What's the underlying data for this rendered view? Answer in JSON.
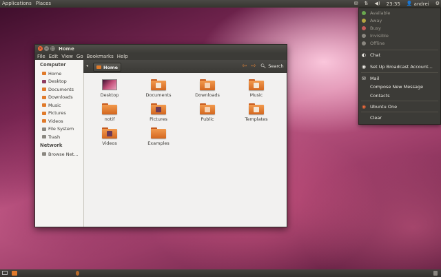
{
  "top_panel": {
    "menu": [
      "Applications",
      "Places"
    ],
    "clock": "23:35",
    "user": "andrei",
    "icons": [
      "mail-icon",
      "network-icon",
      "volume-icon",
      "user-icon",
      "gear-icon"
    ]
  },
  "indicator_menu": {
    "statuses": [
      {
        "label": "Available",
        "color": "#6aa84f"
      },
      {
        "label": "Away",
        "color": "#b5a642"
      },
      {
        "label": "Busy",
        "color": "#c45a5a"
      },
      {
        "label": "Invisible",
        "color": "#8a8780"
      },
      {
        "label": "Offline",
        "color": "#8a8780"
      }
    ],
    "chat": "Chat",
    "broadcast": "Set Up Broadcast Account...",
    "mail": "Mail",
    "compose": "Compose New Message",
    "contacts": "Contacts",
    "ubuntu_one": "Ubuntu One",
    "clear": "Clear"
  },
  "window": {
    "title": "Home",
    "menu": [
      "File",
      "Edit",
      "View",
      "Go",
      "Bookmarks",
      "Help"
    ],
    "path_button": "Home",
    "search": "Search",
    "sidebar": {
      "computer_heading": "Computer",
      "computer_items": [
        {
          "label": "Home",
          "icon": "home-folder-icon",
          "color": "#e07a2a"
        },
        {
          "label": "Desktop",
          "icon": "desktop-icon",
          "color": "#8e3b5f"
        },
        {
          "label": "Documents",
          "icon": "documents-folder-icon",
          "color": "#e07a2a"
        },
        {
          "label": "Downloads",
          "icon": "downloads-folder-icon",
          "color": "#e07a2a"
        },
        {
          "label": "Music",
          "icon": "music-folder-icon",
          "color": "#e07a2a"
        },
        {
          "label": "Pictures",
          "icon": "pictures-folder-icon",
          "color": "#e07a2a"
        },
        {
          "label": "Videos",
          "icon": "videos-folder-icon",
          "color": "#e07a2a"
        },
        {
          "label": "File System",
          "icon": "file-system-icon",
          "color": "#8a8780"
        },
        {
          "label": "Trash",
          "icon": "trash-icon",
          "color": "#8a8780"
        }
      ],
      "network_heading": "Network",
      "network_items": [
        {
          "label": "Browse Net...",
          "icon": "network-icon",
          "color": "#8a8780"
        }
      ]
    },
    "files": [
      {
        "label": "Desktop",
        "type": "desktop",
        "emblem": "desktop-icon"
      },
      {
        "label": "Documents",
        "type": "folder",
        "emblem": "documents-icon",
        "emblem_color": "#f4e7d7"
      },
      {
        "label": "Downloads",
        "type": "folder",
        "emblem": "downloads-icon",
        "emblem_color": "#f6d3b4"
      },
      {
        "label": "Music",
        "type": "folder",
        "emblem": "music-icon",
        "emblem_color": "#f4e7d7"
      },
      {
        "label": "notif",
        "type": "folder",
        "emblem": "",
        "emblem_color": ""
      },
      {
        "label": "Pictures",
        "type": "folder",
        "emblem": "pictures-icon",
        "emblem_color": "#6b3a56"
      },
      {
        "label": "Public",
        "type": "folder",
        "emblem": "public-icon",
        "emblem_color": "#f6d3b4"
      },
      {
        "label": "Templates",
        "type": "folder",
        "emblem": "templates-icon",
        "emblem_color": "#f4e7d7"
      },
      {
        "label": "Videos",
        "type": "folder",
        "emblem": "videos-icon",
        "emblem_color": "#6b3a56"
      },
      {
        "label": "Examples",
        "type": "folder",
        "emblem": "",
        "emblem_color": ""
      }
    ]
  }
}
